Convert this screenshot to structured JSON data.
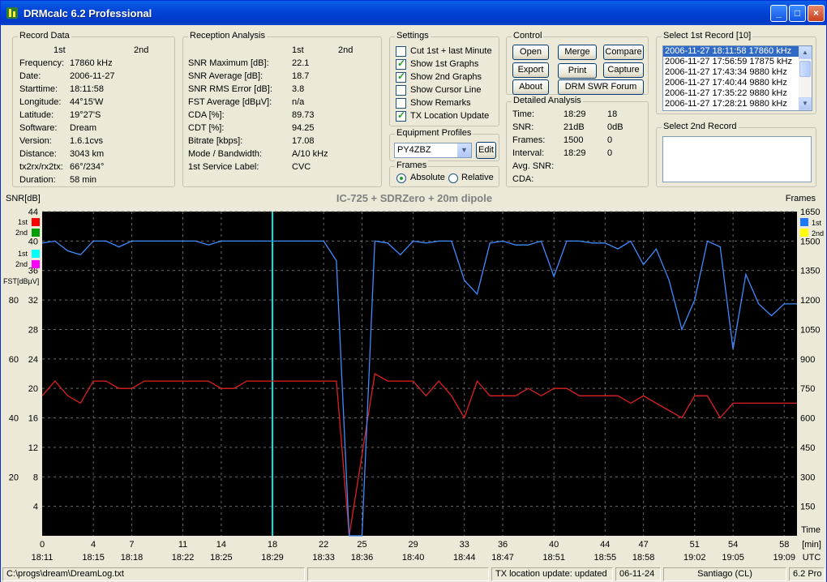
{
  "window": {
    "title": "DRMcalc 6.2 Professional",
    "minimize": "_",
    "maximize": "□",
    "close": "×"
  },
  "record": {
    "group": "Record Data",
    "col1": "1st",
    "col2": "2nd",
    "rows": [
      {
        "label": "Frequency:",
        "v1": "17860 kHz"
      },
      {
        "label": "Date:",
        "v1": "2006-11-27"
      },
      {
        "label": "Starttime:",
        "v1": "18:11:58"
      },
      {
        "label": "Longitude:",
        "v1": "44°15'W"
      },
      {
        "label": "Latitude:",
        "v1": "19°27'S"
      },
      {
        "label": "Software:",
        "v1": "Dream"
      },
      {
        "label": "Version:",
        "v1": "1.6.1cvs"
      },
      {
        "label": "Distance:",
        "v1": "3043 km"
      },
      {
        "label": "tx2rx/rx2tx:",
        "v1": "66°/234°"
      },
      {
        "label": "Duration:",
        "v1": "58 min"
      }
    ]
  },
  "reception": {
    "group": "Reception Analysis",
    "col1": "1st",
    "col2": "2nd",
    "rows": [
      {
        "label": "SNR Maximum [dB]:",
        "v1": "22.1"
      },
      {
        "label": "SNR Average [dB]:",
        "v1": "18.7"
      },
      {
        "label": "SNR RMS Error [dB]:",
        "v1": "3.8"
      },
      {
        "label": "FST Average [dBµV]:",
        "v1": "n/a"
      },
      {
        "label": "CDA [%]:",
        "v1": "89.73"
      },
      {
        "label": "CDT [%]:",
        "v1": "94.25"
      },
      {
        "label": "Bitrate [kbps]:",
        "v1": "17.08"
      },
      {
        "label": "Mode / Bandwidth:",
        "v1": "A/10 kHz"
      },
      {
        "label": "1st Service Label:",
        "v1": "CVC"
      }
    ]
  },
  "settings": {
    "group": "Settings",
    "options": [
      {
        "label": "Cut 1st + last Minute",
        "checked": false
      },
      {
        "label": "Show 1st Graphs",
        "checked": true
      },
      {
        "label": "Show 2nd Graphs",
        "checked": true
      },
      {
        "label": "Show Cursor Line",
        "checked": false
      },
      {
        "label": "Show Remarks",
        "checked": false
      },
      {
        "label": "TX Location Update",
        "checked": true
      }
    ]
  },
  "equipment": {
    "group": "Equipment Profiles",
    "selected": "PY4ZBZ",
    "edit": "Edit"
  },
  "frames": {
    "group": "Frames",
    "absolute": "Absolute",
    "relative": "Relative",
    "selected": "Absolute"
  },
  "control": {
    "group": "Control",
    "open": "Open",
    "merge": "Merge",
    "compare": "Compare",
    "export": "Export",
    "print": "Print",
    "capture": "Capture",
    "about": "About",
    "forum": "DRM SWR Forum"
  },
  "detailed": {
    "group": "Detailed Analysis",
    "rows": [
      {
        "label": "Time:",
        "v1": "18:29",
        "v2": "18"
      },
      {
        "label": "SNR:",
        "v1": "21dB",
        "v2": "0dB"
      },
      {
        "label": "Frames:",
        "v1": "1500",
        "v2": "0"
      },
      {
        "label": "Interval:",
        "v1": "18:29",
        "v2": "0"
      },
      {
        "label": "Avg. SNR:",
        "v1": "",
        "v2": ""
      },
      {
        "label": "CDA:",
        "v1": "",
        "v2": ""
      }
    ]
  },
  "select1": {
    "group": "Select 1st Record [10]",
    "items": [
      "2006-11-27 18:11:58 17860 kHz",
      "2006-11-27 17:56:59 17875 kHz",
      "2006-11-27 17:43:34 9880 kHz",
      "2006-11-27 17:40:44 9880 kHz",
      "2006-11-27 17:35:22 9880 kHz",
      "2006-11-27 17:28:21 9880 kHz"
    ],
    "selected_index": 0
  },
  "select2": {
    "group": "Select 2nd Record"
  },
  "chart_data": {
    "type": "line",
    "title": "IC-725 + SDRZero + 20m dipole",
    "left_axis_label": "SNR[dB]",
    "right_axis_label": "Frames",
    "fst_label": "FST[dBµV]",
    "x_unit_label": "[min]",
    "x_utc_label": "UTC",
    "time_label": "Time",
    "snr_ticks": [
      4,
      8,
      12,
      16,
      20,
      24,
      28,
      32,
      36,
      40,
      44
    ],
    "fst_ticks": [
      20,
      40,
      60,
      80
    ],
    "frames_ticks": [
      150,
      300,
      450,
      600,
      750,
      900,
      1050,
      1200,
      1350,
      1500,
      1650
    ],
    "snr_ylim": [
      0,
      44
    ],
    "frames_ylim": [
      0,
      1650
    ],
    "x_ticks": [
      0,
      4,
      7,
      11,
      14,
      18,
      22,
      25,
      29,
      33,
      36,
      40,
      44,
      47,
      51,
      54,
      58
    ],
    "x_time_labels": [
      "18:11",
      "18:15",
      "18:18",
      "18:22",
      "18:25",
      "18:29",
      "18:33",
      "18:36",
      "18:40",
      "18:44",
      "18:47",
      "18:51",
      "18:55",
      "18:58",
      "19:02",
      "19:05",
      "19:09"
    ],
    "xlim": [
      0,
      59
    ],
    "cursor_x": 18,
    "legend_left": [
      {
        "label": "1st",
        "color": "#ff0000"
      },
      {
        "label": "2nd",
        "color": "#00a000"
      },
      {
        "label": "1st",
        "color": "#00ffff"
      },
      {
        "label": "2nd",
        "color": "#ff00ff"
      }
    ],
    "legend_right": [
      {
        "label": "1st",
        "color": "#1e7bff"
      },
      {
        "label": "2nd",
        "color": "#ffff00"
      }
    ],
    "series": [
      {
        "name": "1st",
        "axis": "snr",
        "color": "#e02020",
        "x": [
          0,
          1,
          2,
          3,
          4,
          5,
          6,
          7,
          8,
          9,
          10,
          11,
          12,
          13,
          14,
          15,
          16,
          17,
          18,
          19,
          20,
          21,
          22,
          23,
          24,
          25,
          26,
          27,
          28,
          29,
          30,
          31,
          32,
          33,
          34,
          35,
          36,
          37,
          38,
          39,
          40,
          41,
          42,
          43,
          44,
          45,
          46,
          47,
          48,
          49,
          50,
          51,
          52,
          53,
          54,
          55,
          56,
          57,
          58,
          59
        ],
        "values": [
          19,
          21,
          19,
          18,
          21,
          21,
          20,
          20,
          21,
          21,
          21,
          21,
          21,
          21,
          20,
          20,
          21,
          21,
          21,
          21,
          21,
          21,
          21,
          21,
          0,
          11,
          22,
          21,
          21,
          21,
          19,
          21,
          19,
          16,
          21,
          19,
          19,
          19,
          20,
          19,
          20,
          20,
          19,
          19,
          19,
          19,
          18,
          19,
          18,
          17,
          16,
          19,
          19,
          16,
          18,
          18,
          18,
          18,
          18,
          18
        ]
      },
      {
        "name": "1st",
        "axis": "frames",
        "color": "#3f8cff",
        "x": [
          0,
          1,
          2,
          3,
          4,
          5,
          6,
          7,
          8,
          9,
          10,
          11,
          12,
          13,
          14,
          15,
          16,
          17,
          18,
          19,
          20,
          21,
          22,
          23,
          24,
          25,
          26,
          27,
          28,
          29,
          30,
          31,
          32,
          33,
          34,
          35,
          36,
          37,
          38,
          39,
          40,
          41,
          42,
          43,
          44,
          45,
          46,
          47,
          48,
          49,
          50,
          51,
          52,
          53,
          54,
          55,
          56,
          57,
          58,
          59
        ],
        "values": [
          1490,
          1500,
          1450,
          1430,
          1500,
          1500,
          1470,
          1500,
          1500,
          1500,
          1500,
          1500,
          1500,
          1480,
          1500,
          1500,
          1500,
          1500,
          1500,
          1500,
          1500,
          1500,
          1500,
          1400,
          0,
          0,
          1500,
          1490,
          1430,
          1500,
          1490,
          1500,
          1500,
          1300,
          1230,
          1490,
          1500,
          1480,
          1480,
          1500,
          1320,
          1500,
          1500,
          1490,
          1490,
          1460,
          1500,
          1380,
          1460,
          1300,
          1050,
          1200,
          1500,
          1470,
          950,
          1330,
          1180,
          1120,
          1180,
          1180
        ]
      }
    ]
  },
  "status": {
    "path": "C:\\progs\\dream\\DreamLog.txt",
    "empty": "",
    "tx_update": "TX location update: updated",
    "date": "06-11-24",
    "location": "Santiago (CL)",
    "version": "6.2 Pro"
  }
}
